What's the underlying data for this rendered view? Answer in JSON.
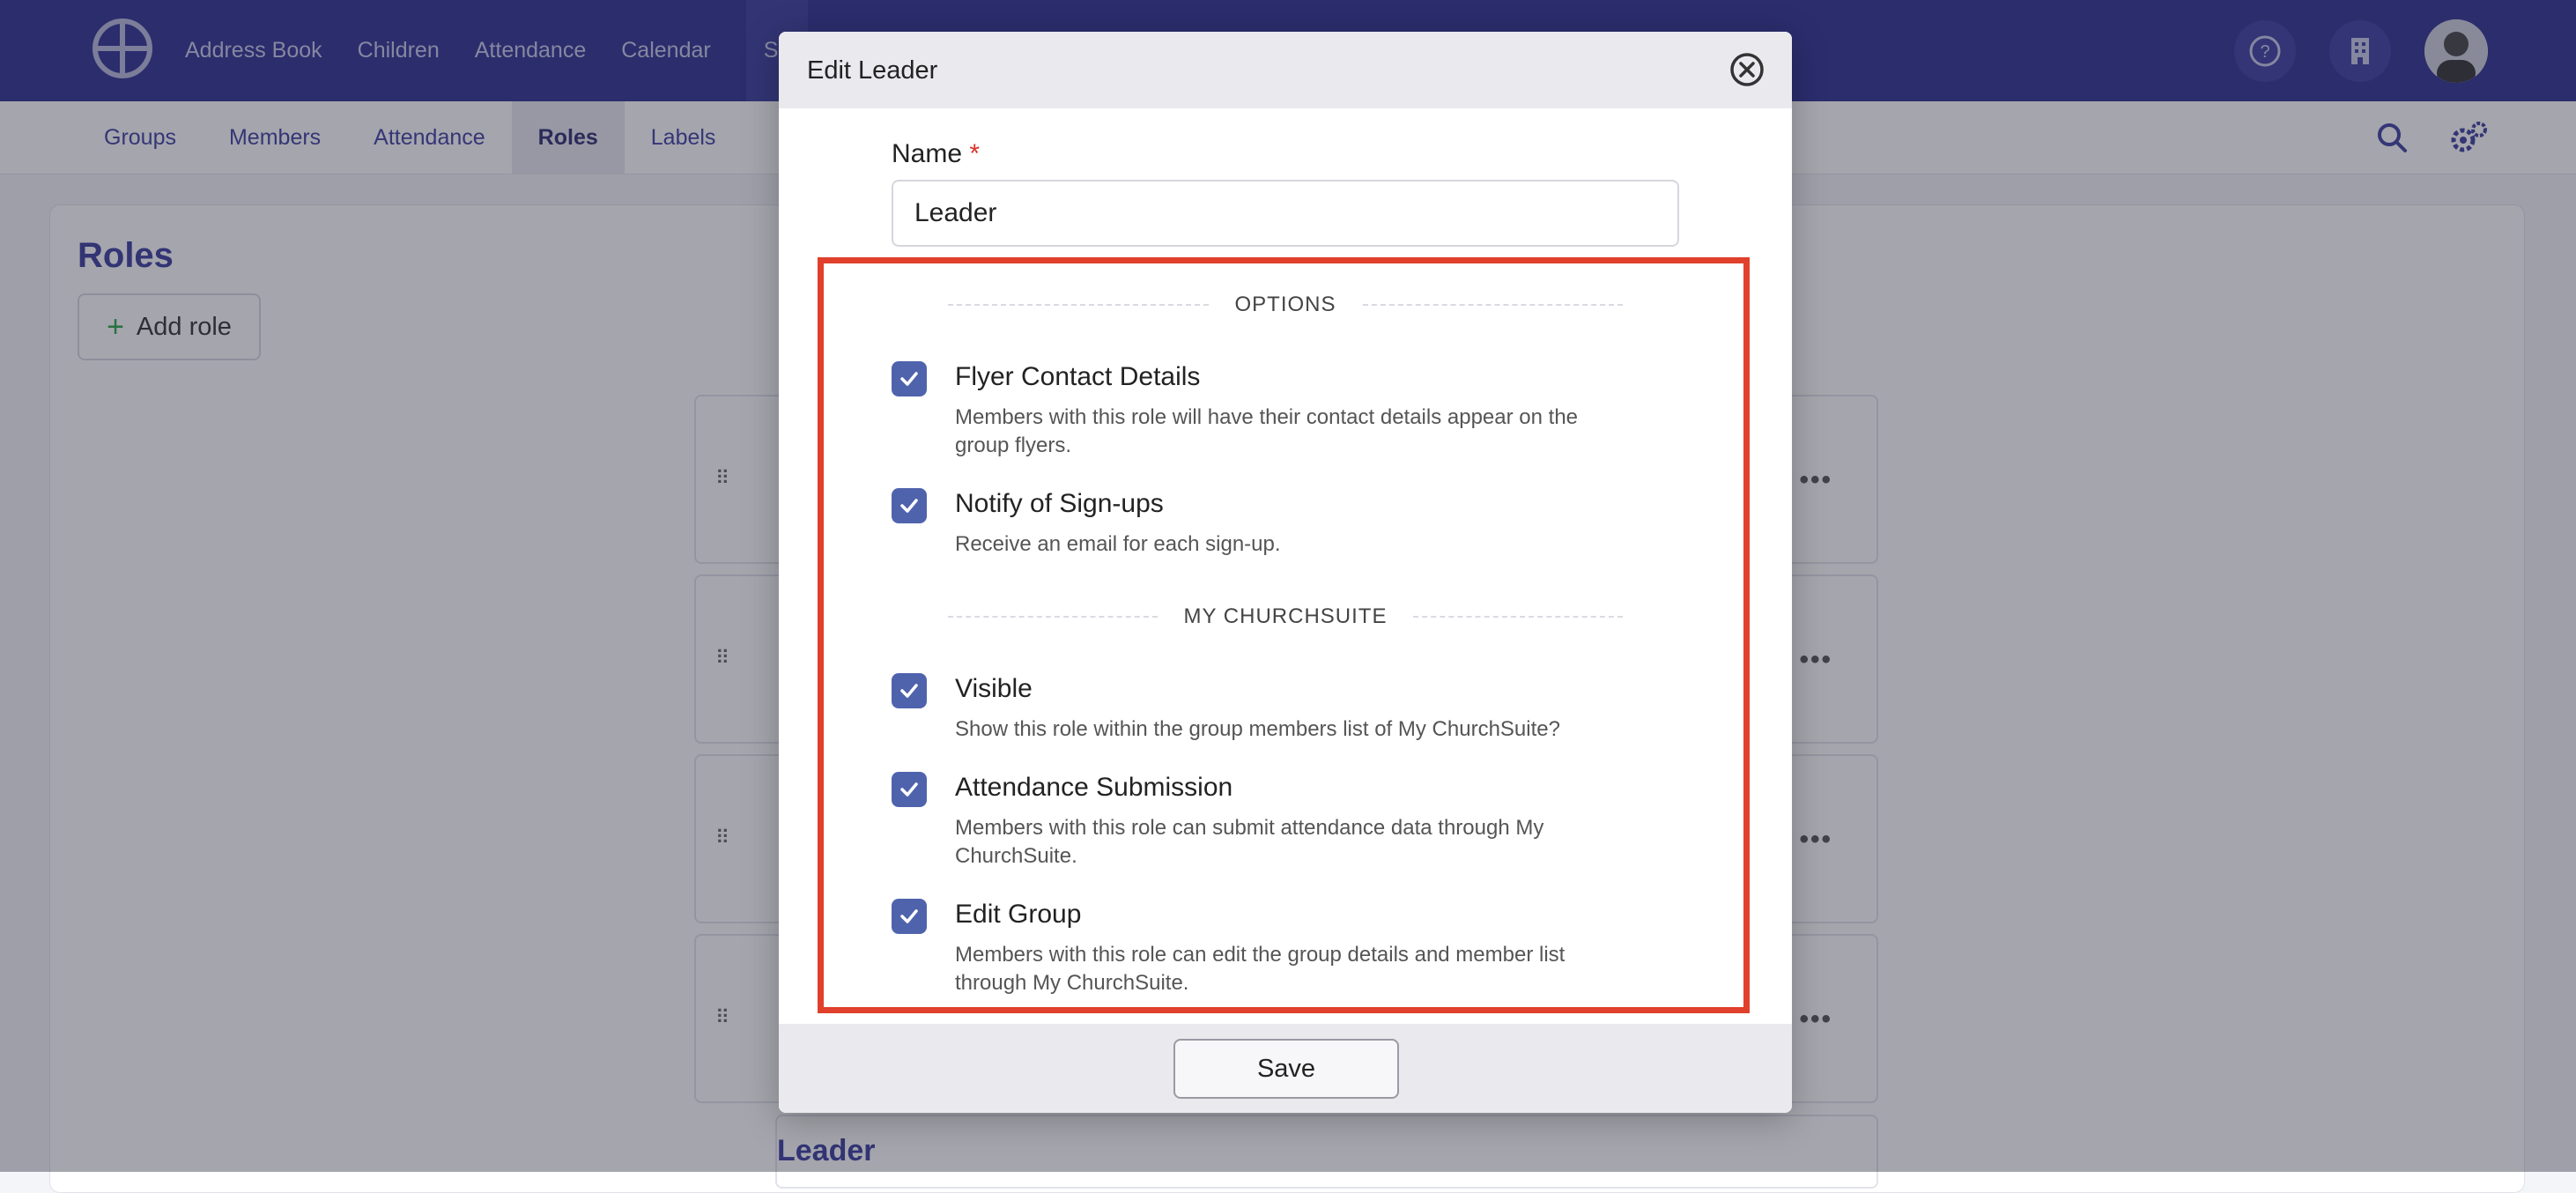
{
  "topnav": {
    "items": [
      "Address Book",
      "Children",
      "Attendance",
      "Calendar",
      "Se"
    ]
  },
  "subnav": {
    "items": [
      "Groups",
      "Members",
      "Attendance",
      "Roles",
      "Labels"
    ]
  },
  "page": {
    "title": "Roles",
    "add_role_label": "Add role",
    "visible_role": "Leader"
  },
  "modal": {
    "title": "Edit Leader",
    "name_label": "Name",
    "required_marker": "*",
    "name_value": "Leader",
    "options_heading": "OPTIONS",
    "options": [
      {
        "title": "Flyer Contact Details",
        "desc": "Members with this role will have their contact details appear on the group flyers.",
        "checked": true
      },
      {
        "title": "Notify of Sign-ups",
        "desc": "Receive an email for each sign-up.",
        "checked": true
      }
    ],
    "mychurchsuite_heading": "MY CHURCHSUITE",
    "mychurchsuite_options": [
      {
        "title": "Visible",
        "desc": "Show this role within the group members list of My ChurchSuite?",
        "checked": true
      },
      {
        "title": "Attendance Submission",
        "desc": "Members with this role can submit attendance data through My ChurchSuite.",
        "checked": true
      },
      {
        "title": "Edit Group",
        "desc": "Members with this role can edit the group details and member list through My ChurchSuite.",
        "checked": true
      }
    ],
    "save_label": "Save"
  },
  "colors": {
    "nav_bg": "#2e3192",
    "checkbox": "#4f63ad",
    "highlight": "#e0402c"
  }
}
